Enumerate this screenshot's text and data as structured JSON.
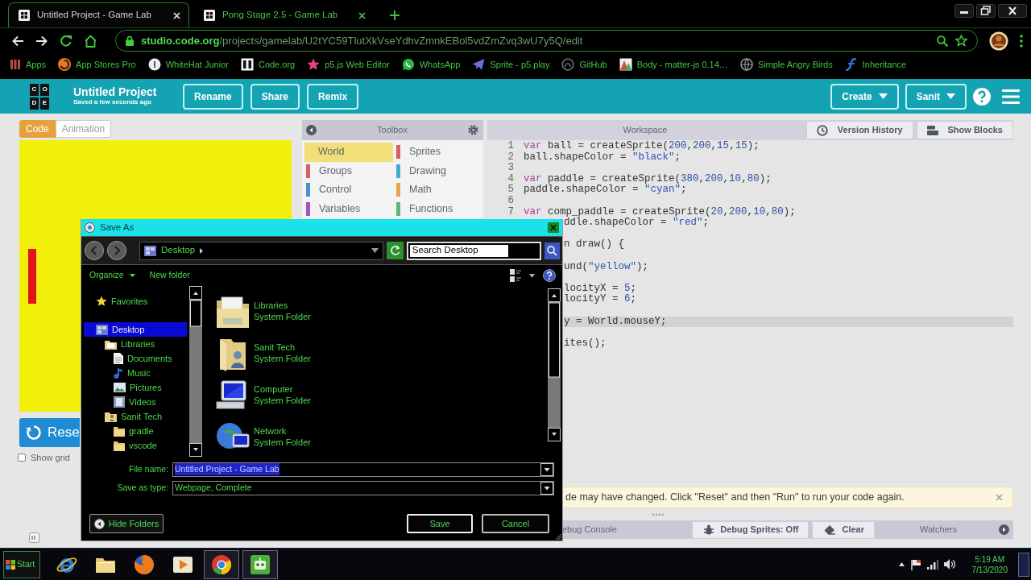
{
  "browser": {
    "tabs": [
      {
        "title": "Untitled Project - Game Lab",
        "selected": true
      },
      {
        "title": "Pong Stage 2.5 - Game Lab",
        "selected": false
      }
    ],
    "address": {
      "domain": "studio.code.org",
      "path": "/projects/gamelab/U2tYC59TlutXkVseYdhvZmnkEBol5vdZmZvq3wU7y5Q/edit"
    },
    "bookmarks": [
      {
        "label": "Apps",
        "kind": "apps"
      },
      {
        "label": "App Stores Pro",
        "kind": "swirl"
      },
      {
        "label": "WhiteHat Junior",
        "kind": "badge"
      },
      {
        "label": "Code.org",
        "kind": "tile"
      },
      {
        "label": "p5.js Web Editor",
        "kind": "star"
      },
      {
        "label": "WhatsApp",
        "kind": "chat"
      },
      {
        "label": "Sprite - p5.play",
        "kind": "plane"
      },
      {
        "label": "GitHub",
        "kind": "cat"
      },
      {
        "label": "Body - matter-js 0.14…",
        "kind": "shapes"
      },
      {
        "label": "Simple Angry Birds",
        "kind": "globe"
      },
      {
        "label": "Inheritance",
        "kind": "script"
      }
    ]
  },
  "app_header": {
    "logo": [
      "C",
      "O",
      "D",
      "E"
    ],
    "title": "Untitled Project",
    "subtitle": "Saved a few seconds ago",
    "buttons": [
      "Rename",
      "Share",
      "Remix"
    ],
    "menus": [
      "Create",
      "Sanit"
    ]
  },
  "view_tabs": [
    {
      "label": "Code",
      "selected": true
    },
    {
      "label": "Animation",
      "selected": false
    }
  ],
  "reset_button": "Rese",
  "show_grid": {
    "label": "Show grid",
    "checked": false
  },
  "toolbox": {
    "title": "Toolbox",
    "categories": [
      {
        "label": "World",
        "color": "#f3df7a",
        "selected": true
      },
      {
        "label": "Sprites",
        "color": "#d95d63",
        "selected": false
      },
      {
        "label": "Groups",
        "color": "#d95d63",
        "selected": false
      },
      {
        "label": "Drawing",
        "color": "#3eafc6",
        "selected": false
      },
      {
        "label": "Control",
        "color": "#4a8ed6",
        "selected": false
      },
      {
        "label": "Math",
        "color": "#e5a34a",
        "selected": false
      },
      {
        "label": "Variables",
        "color": "#a653c2",
        "selected": false
      },
      {
        "label": "Functions",
        "color": "#5cb67f",
        "selected": false
      }
    ]
  },
  "workspace": {
    "title": "Workspace",
    "buttons": [
      {
        "label": "Version History",
        "kind": "history"
      },
      {
        "label": "Show Blocks",
        "kind": "blocks"
      }
    ],
    "lines": [
      {
        "kind": "line",
        "number": "1",
        "text": "var ball = createSprite(200,200,15,15);",
        "current": false
      },
      {
        "kind": "line",
        "number": "2",
        "text": "ball.shapeColor = \"black\";",
        "current": false
      },
      {
        "kind": "line",
        "number": "3",
        "current": false
      },
      {
        "kind": "line",
        "number": "4",
        "text": "var paddle = createSprite(380,200,10,80);",
        "current": false
      },
      {
        "kind": "line",
        "number": "5",
        "text": "paddle.shapeColor = \"cyan\";",
        "current": false
      },
      {
        "kind": "line",
        "number": "6",
        "current": false
      },
      {
        "kind": "line",
        "number": "7",
        "text": "var comp_paddle = createSprite(20,200,10,80);",
        "current": false
      },
      {
        "kind": "partial",
        "text": "ddle.shapeColor = \"red\";",
        "current": false
      },
      {
        "kind": "blank",
        "current": false
      },
      {
        "kind": "partial",
        "text": "n draw() {",
        "current": false
      },
      {
        "kind": "blank",
        "current": false
      },
      {
        "kind": "partial",
        "text": "und(\"yellow\");",
        "current": false
      },
      {
        "kind": "blank",
        "current": false
      },
      {
        "kind": "partial",
        "text": "locityX = 5;",
        "current": false
      },
      {
        "kind": "partial",
        "text": "locityY = 6;",
        "current": false
      },
      {
        "kind": "blank",
        "current": false
      },
      {
        "kind": "partial",
        "text": "y = World.mouseY;",
        "current": true
      },
      {
        "kind": "blank",
        "current": false
      },
      {
        "kind": "partial",
        "text": "ites();",
        "current": false
      }
    ]
  },
  "notice": {
    "text": "de may have changed. Click \"Reset\" and then \"Run\" to run your code again."
  },
  "debug": {
    "console_title": "ebug Console",
    "buttons": [
      {
        "label": "Debug Sprites: Off",
        "kind": "bug"
      },
      {
        "label": "Clear",
        "kind": "eraser"
      }
    ],
    "watchers_title": "Watchers"
  },
  "save_dialog": {
    "title": "Save As",
    "location": "Desktop",
    "search": {
      "placeholder": "Search Desktop"
    },
    "toolbar": [
      {
        "label": "Organize",
        "kind": "menu"
      },
      {
        "label": "New folder",
        "kind": "plain"
      }
    ],
    "nav_tree": [
      {
        "label": "Favorites",
        "kind": "favorites",
        "selected": false
      },
      {
        "label": "Desktop",
        "kind": "desktop",
        "selected": true,
        "children": [
          {
            "label": "Libraries",
            "kind": "library",
            "selected": false,
            "children": [
              {
                "label": "Documents",
                "kind": "documents",
                "selected": false
              },
              {
                "label": "Music",
                "kind": "music",
                "selected": false
              },
              {
                "label": "Pictures",
                "kind": "pictures",
                "selected": false
              },
              {
                "label": "Videos",
                "kind": "videos",
                "selected": false
              }
            ]
          },
          {
            "label": "Sanit Tech",
            "kind": "user",
            "selected": false,
            "children": [
              {
                "label": "gradle",
                "kind": "folder",
                "selected": false
              },
              {
                "label": "vscode",
                "kind": "folder",
                "selected": false
              }
            ]
          }
        ]
      }
    ],
    "files": [
      {
        "name": "Libraries",
        "type": "System Folder",
        "kind": "library"
      },
      {
        "name": "Sanit Tech",
        "type": "System Folder",
        "kind": "user"
      },
      {
        "name": "Computer",
        "type": "System Folder",
        "kind": "computer"
      },
      {
        "name": "Network",
        "type": "System Folder",
        "kind": "network"
      }
    ],
    "fields": [
      {
        "label": "File name:",
        "value": "Untitled Project - Game Lab",
        "selected": true
      },
      {
        "label": "Save as type:",
        "value": "Webpage, Complete",
        "selected": false
      }
    ],
    "buttons": [
      {
        "label": "Hide Folders",
        "kind": "toggle"
      },
      {
        "label": "Save",
        "kind": "default"
      },
      {
        "label": "Cancel",
        "kind": "normal"
      }
    ]
  },
  "taskbar": {
    "start": "Start",
    "apps": [
      {
        "kind": "ie",
        "active": false
      },
      {
        "kind": "folder",
        "active": false
      },
      {
        "kind": "firefox",
        "active": false
      },
      {
        "kind": "media",
        "active": false
      },
      {
        "kind": "chrome",
        "active": true
      },
      {
        "kind": "gamelab",
        "active": true
      }
    ],
    "time": "5:19 AM",
    "date": "7/13/2020"
  }
}
